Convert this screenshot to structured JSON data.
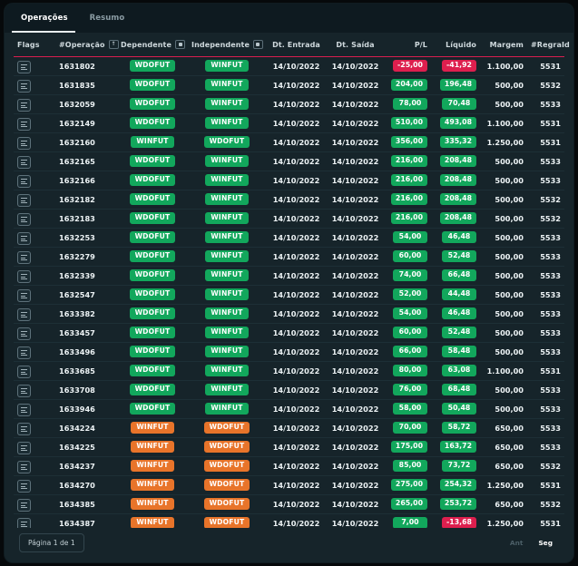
{
  "tabs": [
    {
      "label": "Operações",
      "active": true
    },
    {
      "label": "Resumo",
      "active": false
    }
  ],
  "table": {
    "columns": [
      {
        "key": "flags",
        "label": "Flags",
        "align": "left",
        "sort": null
      },
      {
        "key": "operacao",
        "label": "#Operação",
        "align": "left",
        "sort": "asc-box"
      },
      {
        "key": "dependente",
        "label": "Dependente",
        "align": "center",
        "sort": "filter-box"
      },
      {
        "key": "independente",
        "label": "Independente",
        "align": "center",
        "sort": "filter-box"
      },
      {
        "key": "dt_entrada",
        "label": "Dt. Entrada",
        "align": "center",
        "sort": null
      },
      {
        "key": "dt_saida",
        "label": "Dt. Saída",
        "align": "center",
        "sort": null
      },
      {
        "key": "pl",
        "label": "P/L",
        "align": "right",
        "sort": null
      },
      {
        "key": "liquido",
        "label": "Líquido",
        "align": "right",
        "sort": null
      },
      {
        "key": "margem",
        "label": "Margem",
        "align": "right",
        "sort": null
      },
      {
        "key": "regraid",
        "label": "#RegraId",
        "align": "right",
        "sort": null
      }
    ],
    "flag_icon": "list-lines-icon",
    "rows": [
      {
        "operacao": "1631802",
        "dependente": "WDOFUT",
        "dep_color": "green",
        "independente": "WINFUT",
        "ind_color": "green",
        "dt_entrada": "14/10/2022",
        "dt_saida": "14/10/2022",
        "pl": "-25,00",
        "pl_sign": "neg",
        "liquido": "-41,92",
        "liq_sign": "neg",
        "margem": "1.100,00",
        "regraid": "5531"
      },
      {
        "operacao": "1631835",
        "dependente": "WDOFUT",
        "dep_color": "green",
        "independente": "WINFUT",
        "ind_color": "green",
        "dt_entrada": "14/10/2022",
        "dt_saida": "14/10/2022",
        "pl": "204,00",
        "pl_sign": "pos",
        "liquido": "196,48",
        "liq_sign": "pos",
        "margem": "500,00",
        "regraid": "5532"
      },
      {
        "operacao": "1632059",
        "dependente": "WDOFUT",
        "dep_color": "green",
        "independente": "WINFUT",
        "ind_color": "green",
        "dt_entrada": "14/10/2022",
        "dt_saida": "14/10/2022",
        "pl": "78,00",
        "pl_sign": "pos",
        "liquido": "70,48",
        "liq_sign": "pos",
        "margem": "500,00",
        "regraid": "5533"
      },
      {
        "operacao": "1632149",
        "dependente": "WDOFUT",
        "dep_color": "green",
        "independente": "WINFUT",
        "ind_color": "green",
        "dt_entrada": "14/10/2022",
        "dt_saida": "14/10/2022",
        "pl": "510,00",
        "pl_sign": "pos",
        "liquido": "493,08",
        "liq_sign": "pos",
        "margem": "1.100,00",
        "regraid": "5531"
      },
      {
        "operacao": "1632160",
        "dependente": "WINFUT",
        "dep_color": "green",
        "independente": "WDOFUT",
        "ind_color": "green",
        "dt_entrada": "14/10/2022",
        "dt_saida": "14/10/2022",
        "pl": "356,00",
        "pl_sign": "pos",
        "liquido": "335,32",
        "liq_sign": "pos",
        "margem": "1.250,00",
        "regraid": "5531"
      },
      {
        "operacao": "1632165",
        "dependente": "WDOFUT",
        "dep_color": "green",
        "independente": "WINFUT",
        "ind_color": "green",
        "dt_entrada": "14/10/2022",
        "dt_saida": "14/10/2022",
        "pl": "216,00",
        "pl_sign": "pos",
        "liquido": "208,48",
        "liq_sign": "pos",
        "margem": "500,00",
        "regraid": "5533"
      },
      {
        "operacao": "1632166",
        "dependente": "WDOFUT",
        "dep_color": "green",
        "independente": "WINFUT",
        "ind_color": "green",
        "dt_entrada": "14/10/2022",
        "dt_saida": "14/10/2022",
        "pl": "216,00",
        "pl_sign": "pos",
        "liquido": "208,48",
        "liq_sign": "pos",
        "margem": "500,00",
        "regraid": "5533"
      },
      {
        "operacao": "1632182",
        "dependente": "WDOFUT",
        "dep_color": "green",
        "independente": "WINFUT",
        "ind_color": "green",
        "dt_entrada": "14/10/2022",
        "dt_saida": "14/10/2022",
        "pl": "216,00",
        "pl_sign": "pos",
        "liquido": "208,48",
        "liq_sign": "pos",
        "margem": "500,00",
        "regraid": "5532"
      },
      {
        "operacao": "1632183",
        "dependente": "WDOFUT",
        "dep_color": "green",
        "independente": "WINFUT",
        "ind_color": "green",
        "dt_entrada": "14/10/2022",
        "dt_saida": "14/10/2022",
        "pl": "216,00",
        "pl_sign": "pos",
        "liquido": "208,48",
        "liq_sign": "pos",
        "margem": "500,00",
        "regraid": "5532"
      },
      {
        "operacao": "1632253",
        "dependente": "WDOFUT",
        "dep_color": "green",
        "independente": "WINFUT",
        "ind_color": "green",
        "dt_entrada": "14/10/2022",
        "dt_saida": "14/10/2022",
        "pl": "54,00",
        "pl_sign": "pos",
        "liquido": "46,48",
        "liq_sign": "pos",
        "margem": "500,00",
        "regraid": "5533"
      },
      {
        "operacao": "1632279",
        "dependente": "WDOFUT",
        "dep_color": "green",
        "independente": "WINFUT",
        "ind_color": "green",
        "dt_entrada": "14/10/2022",
        "dt_saida": "14/10/2022",
        "pl": "60,00",
        "pl_sign": "pos",
        "liquido": "52,48",
        "liq_sign": "pos",
        "margem": "500,00",
        "regraid": "5533"
      },
      {
        "operacao": "1632339",
        "dependente": "WDOFUT",
        "dep_color": "green",
        "independente": "WINFUT",
        "ind_color": "green",
        "dt_entrada": "14/10/2022",
        "dt_saida": "14/10/2022",
        "pl": "74,00",
        "pl_sign": "pos",
        "liquido": "66,48",
        "liq_sign": "pos",
        "margem": "500,00",
        "regraid": "5533"
      },
      {
        "operacao": "1632547",
        "dependente": "WDOFUT",
        "dep_color": "green",
        "independente": "WINFUT",
        "ind_color": "green",
        "dt_entrada": "14/10/2022",
        "dt_saida": "14/10/2022",
        "pl": "52,00",
        "pl_sign": "pos",
        "liquido": "44,48",
        "liq_sign": "pos",
        "margem": "500,00",
        "regraid": "5533"
      },
      {
        "operacao": "1633382",
        "dependente": "WDOFUT",
        "dep_color": "green",
        "independente": "WINFUT",
        "ind_color": "green",
        "dt_entrada": "14/10/2022",
        "dt_saida": "14/10/2022",
        "pl": "54,00",
        "pl_sign": "pos",
        "liquido": "46,48",
        "liq_sign": "pos",
        "margem": "500,00",
        "regraid": "5533"
      },
      {
        "operacao": "1633457",
        "dependente": "WDOFUT",
        "dep_color": "green",
        "independente": "WINFUT",
        "ind_color": "green",
        "dt_entrada": "14/10/2022",
        "dt_saida": "14/10/2022",
        "pl": "60,00",
        "pl_sign": "pos",
        "liquido": "52,48",
        "liq_sign": "pos",
        "margem": "500,00",
        "regraid": "5533"
      },
      {
        "operacao": "1633496",
        "dependente": "WDOFUT",
        "dep_color": "green",
        "independente": "WINFUT",
        "ind_color": "green",
        "dt_entrada": "14/10/2022",
        "dt_saida": "14/10/2022",
        "pl": "66,00",
        "pl_sign": "pos",
        "liquido": "58,48",
        "liq_sign": "pos",
        "margem": "500,00",
        "regraid": "5533"
      },
      {
        "operacao": "1633685",
        "dependente": "WDOFUT",
        "dep_color": "green",
        "independente": "WINFUT",
        "ind_color": "green",
        "dt_entrada": "14/10/2022",
        "dt_saida": "14/10/2022",
        "pl": "80,00",
        "pl_sign": "pos",
        "liquido": "63,08",
        "liq_sign": "pos",
        "margem": "1.100,00",
        "regraid": "5531"
      },
      {
        "operacao": "1633708",
        "dependente": "WDOFUT",
        "dep_color": "green",
        "independente": "WINFUT",
        "ind_color": "green",
        "dt_entrada": "14/10/2022",
        "dt_saida": "14/10/2022",
        "pl": "76,00",
        "pl_sign": "pos",
        "liquido": "68,48",
        "liq_sign": "pos",
        "margem": "500,00",
        "regraid": "5533"
      },
      {
        "operacao": "1633946",
        "dependente": "WDOFUT",
        "dep_color": "green",
        "independente": "WINFUT",
        "ind_color": "green",
        "dt_entrada": "14/10/2022",
        "dt_saida": "14/10/2022",
        "pl": "58,00",
        "pl_sign": "pos",
        "liquido": "50,48",
        "liq_sign": "pos",
        "margem": "500,00",
        "regraid": "5533"
      },
      {
        "operacao": "1634224",
        "dependente": "WINFUT",
        "dep_color": "orange",
        "independente": "WDOFUT",
        "ind_color": "orange",
        "dt_entrada": "14/10/2022",
        "dt_saida": "14/10/2022",
        "pl": "70,00",
        "pl_sign": "pos",
        "liquido": "58,72",
        "liq_sign": "pos",
        "margem": "650,00",
        "regraid": "5533"
      },
      {
        "operacao": "1634225",
        "dependente": "WINFUT",
        "dep_color": "orange",
        "independente": "WDOFUT",
        "ind_color": "orange",
        "dt_entrada": "14/10/2022",
        "dt_saida": "14/10/2022",
        "pl": "175,00",
        "pl_sign": "pos",
        "liquido": "163,72",
        "liq_sign": "pos",
        "margem": "650,00",
        "regraid": "5533"
      },
      {
        "operacao": "1634237",
        "dependente": "WINFUT",
        "dep_color": "orange",
        "independente": "WDOFUT",
        "ind_color": "orange",
        "dt_entrada": "14/10/2022",
        "dt_saida": "14/10/2022",
        "pl": "85,00",
        "pl_sign": "pos",
        "liquido": "73,72",
        "liq_sign": "pos",
        "margem": "650,00",
        "regraid": "5532"
      },
      {
        "operacao": "1634270",
        "dependente": "WINFUT",
        "dep_color": "orange",
        "independente": "WDOFUT",
        "ind_color": "orange",
        "dt_entrada": "14/10/2022",
        "dt_saida": "14/10/2022",
        "pl": "275,00",
        "pl_sign": "pos",
        "liquido": "254,32",
        "liq_sign": "pos",
        "margem": "1.250,00",
        "regraid": "5531"
      },
      {
        "operacao": "1634385",
        "dependente": "WINFUT",
        "dep_color": "orange",
        "independente": "WDOFUT",
        "ind_color": "orange",
        "dt_entrada": "14/10/2022",
        "dt_saida": "14/10/2022",
        "pl": "265,00",
        "pl_sign": "pos",
        "liquido": "253,72",
        "liq_sign": "pos",
        "margem": "650,00",
        "regraid": "5532"
      },
      {
        "operacao": "1634387",
        "dependente": "WINFUT",
        "dep_color": "orange",
        "independente": "WDOFUT",
        "ind_color": "orange",
        "dt_entrada": "14/10/2022",
        "dt_saida": "14/10/2022",
        "pl": "7,00",
        "pl_sign": "pos",
        "liquido": "-13,68",
        "liq_sign": "neg",
        "margem": "1.250,00",
        "regraid": "5531"
      }
    ]
  },
  "footer": {
    "page_label": "Página 1 de 1",
    "prev_label": "Ant",
    "next_label": "Seg",
    "prev_disabled": true
  },
  "colors": {
    "positive": "#12a75c",
    "negative": "#dd1f4e",
    "badge_alt": "#e8742a",
    "header_rule": "#d81e4f",
    "panel_bg": "#16242a",
    "tabbar_bg": "#0e1a20"
  }
}
